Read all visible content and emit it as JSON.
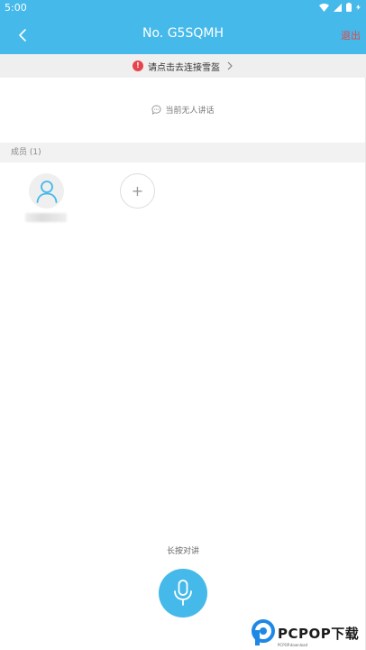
{
  "status_bar": {
    "time": "5:00"
  },
  "header": {
    "title": "No. G5SQMH",
    "exit_label": "退出"
  },
  "banner": {
    "badge": "!",
    "text": "请点击去连接雪盔"
  },
  "speaker": {
    "status_text": "当前无人讲话"
  },
  "members": {
    "header": "成员 (1)",
    "add_label": "+"
  },
  "talk": {
    "hint": "长按对讲"
  },
  "watermark": {
    "brand": "PCPOP下载",
    "sub": "PCPOP.download"
  },
  "colors": {
    "primary": "#44b9ea",
    "exit": "#e84545",
    "alert": "#e8434c"
  }
}
